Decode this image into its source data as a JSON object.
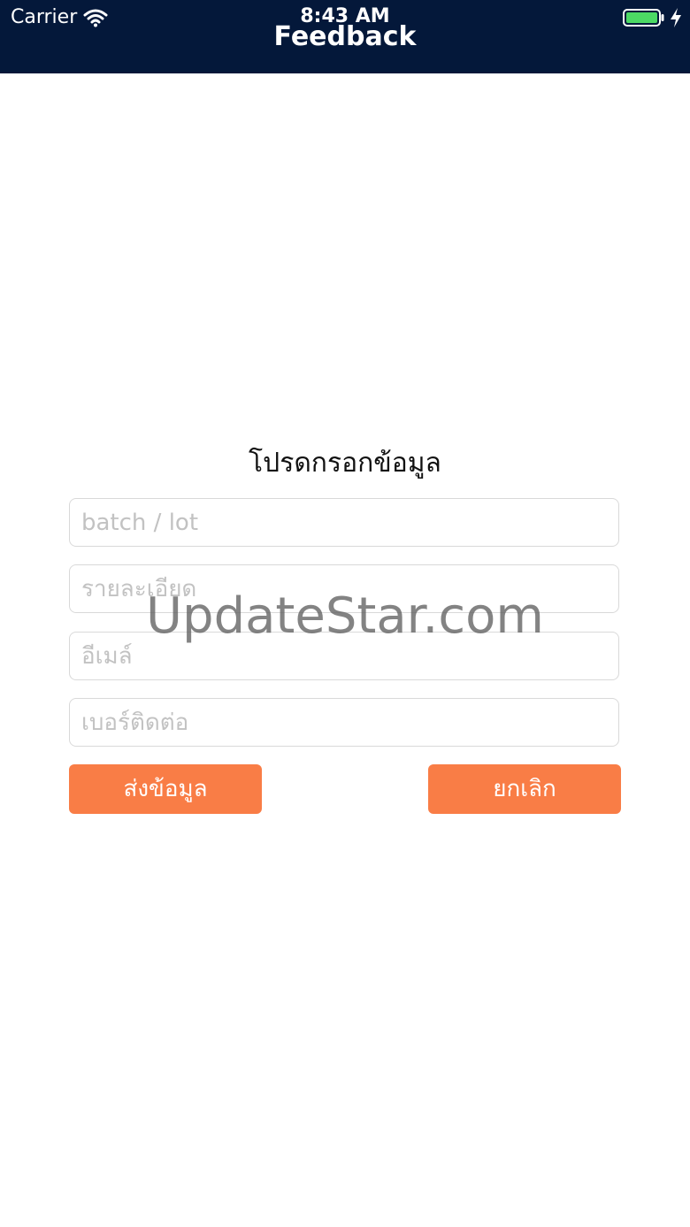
{
  "status_bar": {
    "carrier": "Carrier",
    "time": "8:43 AM",
    "wifi_icon": "wifi-icon",
    "battery_icon": "battery-icon",
    "charging_icon": "charging-bolt-icon"
  },
  "nav": {
    "title": "Feedback"
  },
  "form": {
    "title": "โปรดกรอกข้อมูล",
    "fields": [
      {
        "placeholder": "batch / lot",
        "value": ""
      },
      {
        "placeholder": "รายละเอียด",
        "value": ""
      },
      {
        "placeholder": "อีเมล์",
        "value": ""
      },
      {
        "placeholder": "เบอร์ติดต่อ",
        "value": ""
      }
    ],
    "submit_label": "ส่งข้อมูล",
    "cancel_label": "ยกเลิก"
  },
  "watermark": "UpdateStar.com",
  "colors": {
    "header_bg": "#04183a",
    "button_bg": "#f97d46",
    "battery_fill": "#4cd964"
  }
}
